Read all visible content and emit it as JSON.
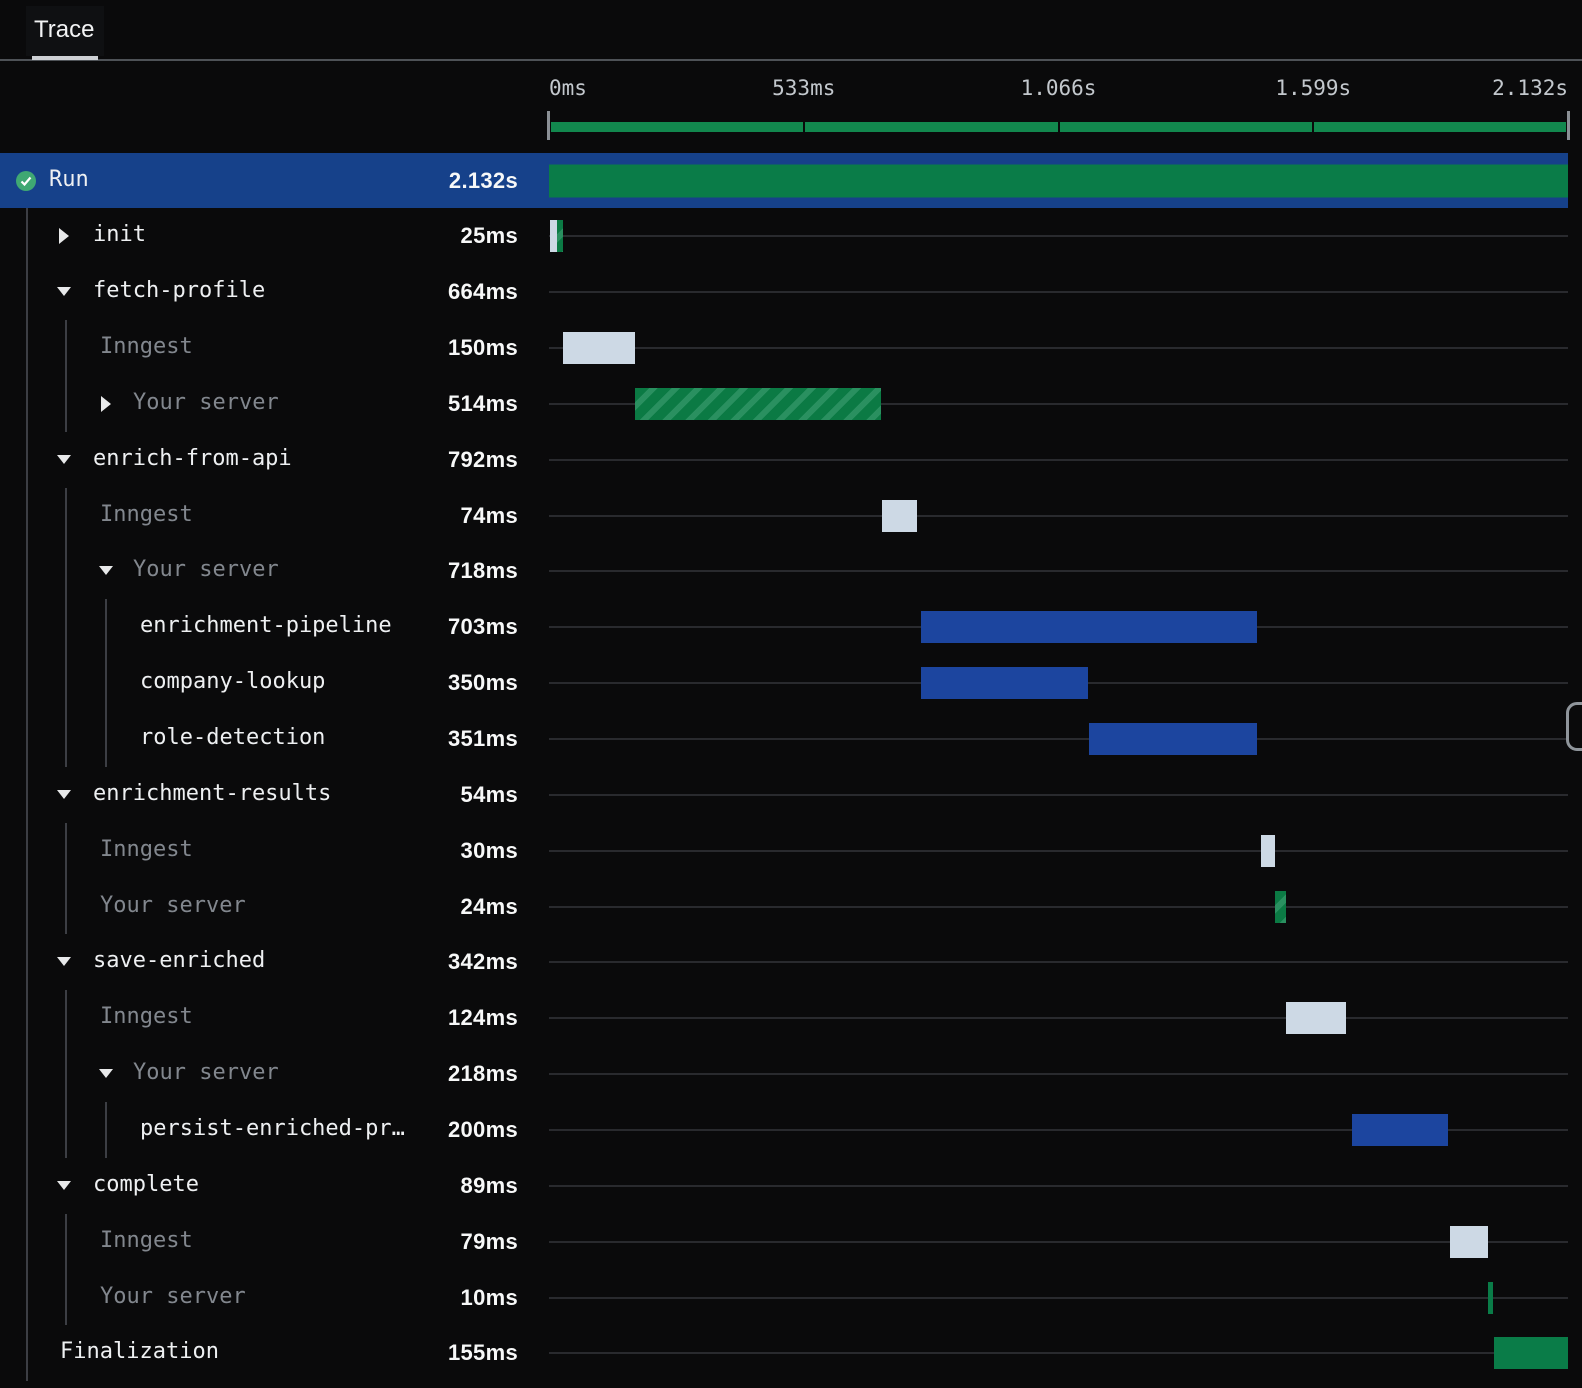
{
  "tab": {
    "label": "Trace"
  },
  "timeline": {
    "total_ms": 2132,
    "ticks": [
      {
        "label": "0ms",
        "ms": 0
      },
      {
        "label": "533ms",
        "ms": 533
      },
      {
        "label": "1.066s",
        "ms": 1066
      },
      {
        "label": "1.599s",
        "ms": 1599
      },
      {
        "label": "2.132s",
        "ms": 2132
      }
    ]
  },
  "rows": [
    {
      "name": "Run",
      "duration": "2.132s",
      "level": 0,
      "arrow": "none",
      "icon": "check-circle",
      "selected": true,
      "gray": false,
      "bars": [
        {
          "type": "run",
          "start": 0,
          "dur": 2132
        }
      ]
    },
    {
      "name": "init",
      "duration": "25ms",
      "level": 1,
      "arrow": "collapsed",
      "gray": false,
      "bars": [
        {
          "type": "inngest",
          "start": 3,
          "dur": 14
        },
        {
          "type": "hatch",
          "start": 17,
          "dur": 13
        }
      ]
    },
    {
      "name": "fetch-profile",
      "duration": "664ms",
      "level": 1,
      "arrow": "expanded",
      "gray": false,
      "bars": []
    },
    {
      "name": "Inngest",
      "duration": "150ms",
      "level": 2,
      "arrow": "none",
      "gray": true,
      "bars": [
        {
          "type": "inngest",
          "start": 29,
          "dur": 150
        }
      ]
    },
    {
      "name": "Your server",
      "duration": "514ms",
      "level": 2,
      "arrow": "collapsed",
      "gray": true,
      "bars": [
        {
          "type": "hatch",
          "start": 180,
          "dur": 514
        }
      ]
    },
    {
      "name": "enrich-from-api",
      "duration": "792ms",
      "level": 1,
      "arrow": "expanded",
      "gray": false,
      "bars": []
    },
    {
      "name": "Inngest",
      "duration": "74ms",
      "level": 2,
      "arrow": "none",
      "gray": true,
      "bars": [
        {
          "type": "inngest",
          "start": 696,
          "dur": 74
        }
      ]
    },
    {
      "name": "Your server",
      "duration": "718ms",
      "level": 2,
      "arrow": "expanded",
      "gray": true,
      "bars": []
    },
    {
      "name": "enrichment-pipeline",
      "duration": "703ms",
      "level": 3,
      "arrow": "none",
      "gray": false,
      "bars": [
        {
          "type": "blue",
          "start": 778,
          "dur": 703
        }
      ]
    },
    {
      "name": "company-lookup",
      "duration": "350ms",
      "level": 3,
      "arrow": "none",
      "gray": false,
      "bars": [
        {
          "type": "blue",
          "start": 778,
          "dur": 350
        }
      ]
    },
    {
      "name": "role-detection",
      "duration": "351ms",
      "level": 3,
      "arrow": "none",
      "gray": false,
      "bars": [
        {
          "type": "blue",
          "start": 1130,
          "dur": 351
        }
      ]
    },
    {
      "name": "enrichment-results",
      "duration": "54ms",
      "level": 1,
      "arrow": "expanded",
      "gray": false,
      "bars": []
    },
    {
      "name": "Inngest",
      "duration": "30ms",
      "level": 2,
      "arrow": "none",
      "gray": true,
      "bars": [
        {
          "type": "inngest",
          "start": 1489,
          "dur": 30
        }
      ]
    },
    {
      "name": "Your server",
      "duration": "24ms",
      "level": 2,
      "arrow": "none",
      "gray": true,
      "bars": [
        {
          "type": "hatch",
          "start": 1519,
          "dur": 24
        }
      ]
    },
    {
      "name": "save-enriched",
      "duration": "342ms",
      "level": 1,
      "arrow": "expanded",
      "gray": false,
      "bars": []
    },
    {
      "name": "Inngest",
      "duration": "124ms",
      "level": 2,
      "arrow": "none",
      "gray": true,
      "bars": [
        {
          "type": "inngest",
          "start": 1543,
          "dur": 124
        }
      ]
    },
    {
      "name": "Your server",
      "duration": "218ms",
      "level": 2,
      "arrow": "expanded",
      "gray": true,
      "bars": []
    },
    {
      "name": "persist-enriched-pr…",
      "duration": "200ms",
      "level": 3,
      "arrow": "none",
      "gray": false,
      "bars": [
        {
          "type": "blue",
          "start": 1681,
          "dur": 200
        }
      ]
    },
    {
      "name": "complete",
      "duration": "89ms",
      "level": 1,
      "arrow": "expanded",
      "gray": false,
      "bars": []
    },
    {
      "name": "Inngest",
      "duration": "79ms",
      "level": 2,
      "arrow": "none",
      "gray": true,
      "bars": [
        {
          "type": "inngest",
          "start": 1885,
          "dur": 79
        }
      ]
    },
    {
      "name": "Your server",
      "duration": "10ms",
      "level": 2,
      "arrow": "none",
      "gray": true,
      "bars": [
        {
          "type": "green",
          "start": 1965,
          "dur": 10
        }
      ]
    },
    {
      "name": "Finalization",
      "duration": "155ms",
      "level": "final",
      "arrow": "none",
      "gray": false,
      "bars": [
        {
          "type": "green",
          "start": 1977,
          "dur": 155
        }
      ]
    }
  ],
  "colors": {
    "selected_row": "#1d48a6",
    "bar_blue": "#1c459f",
    "bar_green": "#0d8449",
    "bar_light": "#cdd9e5",
    "ruler_green": "#12884e",
    "check_green": "#3fa873"
  },
  "scrollbar": {
    "visible": true
  }
}
